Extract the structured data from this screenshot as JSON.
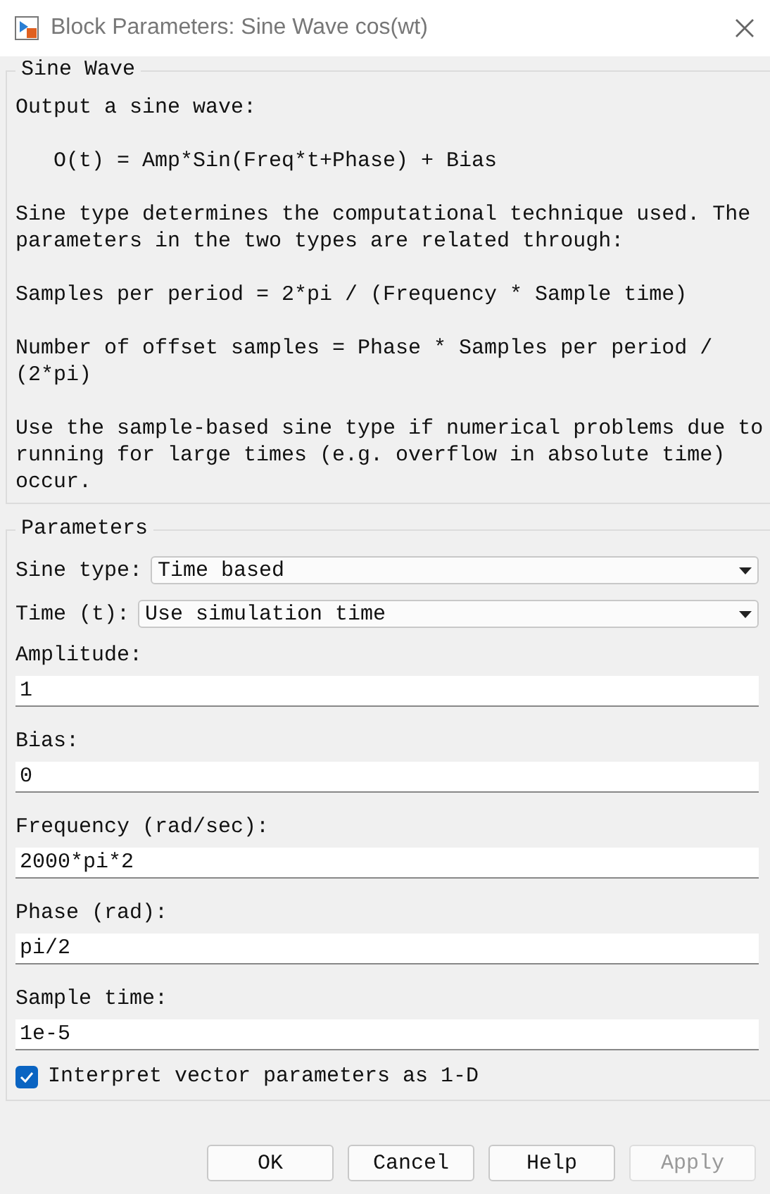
{
  "window": {
    "title": "Block Parameters: Sine Wave cos(wt)"
  },
  "description": {
    "title": "Sine Wave",
    "paragraphs": [
      {
        "kind": "text",
        "text": "Output a sine wave:"
      },
      {
        "kind": "formula",
        "text": "O(t) = Amp*Sin(Freq*t+Phase) + Bias"
      },
      {
        "kind": "text",
        "text": "Sine type determines the computational technique used. The parameters in the two types are related through:"
      },
      {
        "kind": "text",
        "text": "Samples per period = 2*pi / (Frequency * Sample time)"
      },
      {
        "kind": "text",
        "text": "Number of offset samples = Phase * Samples per period / (2*pi)"
      },
      {
        "kind": "text",
        "text": "Use the sample-based sine type if numerical problems due to running for large times (e.g. overflow in absolute time) occur."
      }
    ]
  },
  "parameters": {
    "title": "Parameters",
    "dropdowns": [
      {
        "label": "Sine type:",
        "value": "Time based"
      },
      {
        "label": "Time (t):",
        "value": "Use simulation time"
      }
    ],
    "fields": [
      {
        "label": "Amplitude:",
        "value": "1"
      },
      {
        "label": "Bias:",
        "value": "0"
      },
      {
        "label": "Frequency (rad/sec):",
        "value": "2000*pi*2"
      },
      {
        "label": "Phase (rad):",
        "value": "pi/2"
      },
      {
        "label": "Sample time:",
        "value": "1e-5"
      }
    ],
    "checkbox": {
      "label": "Interpret vector parameters as 1-D",
      "checked": true
    }
  },
  "buttons": [
    {
      "label": "OK",
      "disabled": false
    },
    {
      "label": "Cancel",
      "disabled": false
    },
    {
      "label": "Help",
      "disabled": false
    },
    {
      "label": "Apply",
      "disabled": true
    }
  ]
}
